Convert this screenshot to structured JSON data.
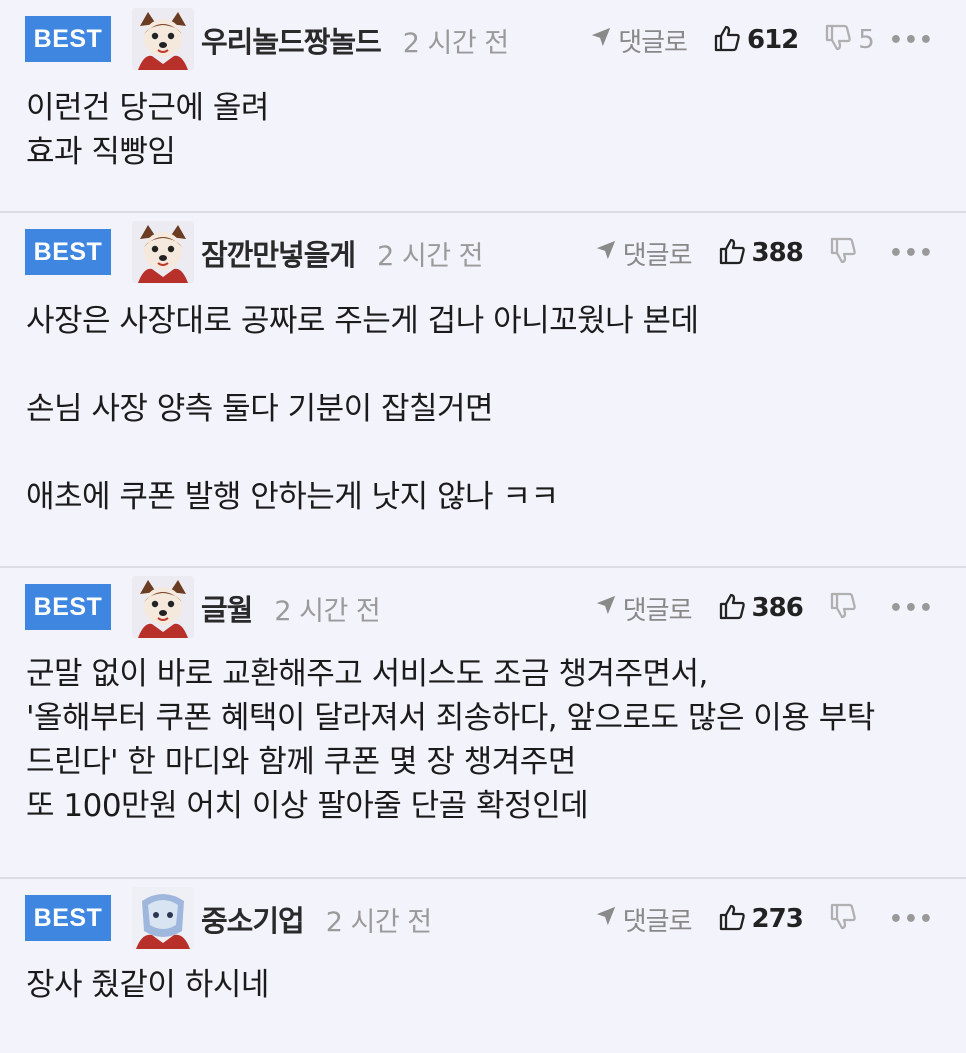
{
  "comments": [
    {
      "badge": "BEST",
      "nickname": "우리놀드짱놀드",
      "time": "2 시간 전",
      "reply_label": "댓글로",
      "upvotes": "612",
      "downvotes": "5",
      "avatar": "fox-avatar-icon",
      "lines": [
        "이런건 당근에 올려",
        "효과 직빵임"
      ]
    },
    {
      "badge": "BEST",
      "nickname": "잠깐만넣을게",
      "time": "2 시간 전",
      "reply_label": "댓글로",
      "upvotes": "388",
      "downvotes": "",
      "avatar": "fox-avatar-icon",
      "lines": [
        "사장은 사장대로 공짜로 주는게 겁나 아니꼬웠나 본데",
        "",
        "손님 사장 양측 둘다 기분이 잡칠거면",
        "",
        "애초에 쿠폰 발행 안하는게 낫지 않나 ㅋㅋ"
      ]
    },
    {
      "badge": "BEST",
      "nickname": "글월",
      "time": "2 시간 전",
      "reply_label": "댓글로",
      "upvotes": "386",
      "downvotes": "",
      "avatar": "fox-avatar-icon",
      "lines": [
        "군말 없이 바로 교환해주고 서비스도 조금 챙겨주면서,",
        "'올해부터 쿠폰 혜택이 달라져서 죄송하다, 앞으로도 많은 이용 부탁",
        "드린다' 한 마디와 함께 쿠폰 몇 장 챙겨주면",
        "또 100만원 어치 이상 팔아줄 단골 확정인데"
      ]
    },
    {
      "badge": "BEST",
      "nickname": "중소기업",
      "time": "2 시간 전",
      "reply_label": "댓글로",
      "upvotes": "273",
      "downvotes": "",
      "avatar": "robot-avatar-icon",
      "lines": [
        "장사 줬같이 하시네"
      ]
    }
  ],
  "colors": {
    "background": "#f3f3fb",
    "badge": "#3f86e0",
    "divider": "#dcdce4",
    "muted": "#9a9a9a"
  }
}
